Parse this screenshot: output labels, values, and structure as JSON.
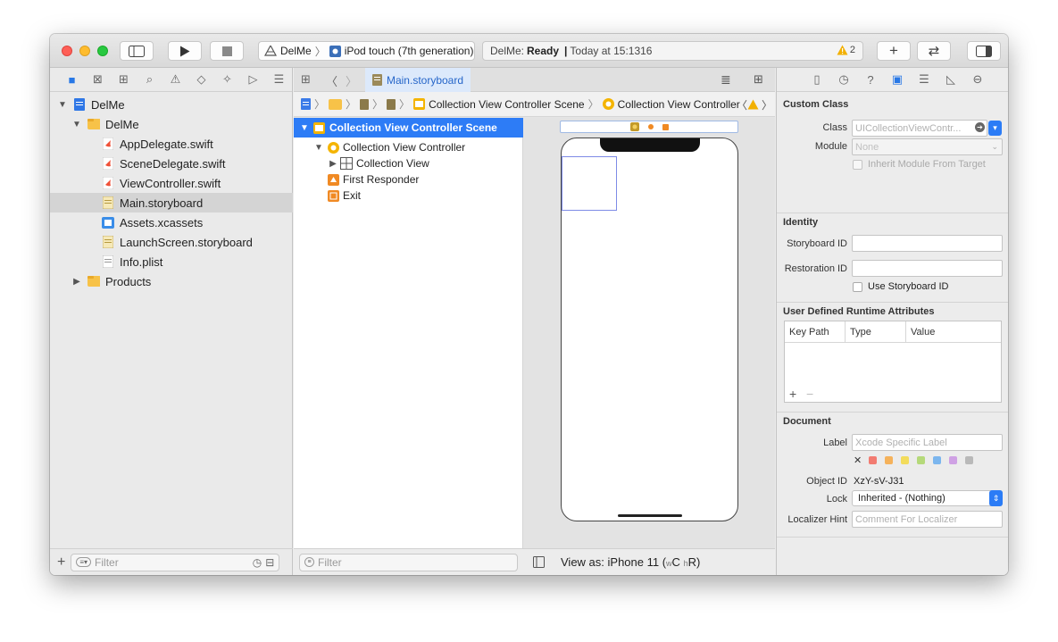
{
  "toolbar": {
    "scheme_project": "DelMe",
    "scheme_device": "iPod touch (7th generation)",
    "status_project": "DelMe:",
    "status_state": "Ready",
    "status_separator": "|",
    "status_time": "Today at 15:1316",
    "warning_count": "2",
    "add_label": "+",
    "swap_label": "⇄"
  },
  "navigator": {
    "tree": [
      {
        "label": "DelMe",
        "level": 0,
        "kind": "project",
        "expanded": true
      },
      {
        "label": "DelMe",
        "level": 1,
        "kind": "folder",
        "expanded": true
      },
      {
        "label": "AppDelegate.swift",
        "level": 2,
        "kind": "swift"
      },
      {
        "label": "SceneDelegate.swift",
        "level": 2,
        "kind": "swift"
      },
      {
        "label": "ViewController.swift",
        "level": 2,
        "kind": "swift"
      },
      {
        "label": "Main.storyboard",
        "level": 2,
        "kind": "storyboard",
        "selected": true
      },
      {
        "label": "Assets.xcassets",
        "level": 2,
        "kind": "assets"
      },
      {
        "label": "LaunchScreen.storyboard",
        "level": 2,
        "kind": "storyboard"
      },
      {
        "label": "Info.plist",
        "level": 2,
        "kind": "plist"
      },
      {
        "label": "Products",
        "level": 1,
        "kind": "folder",
        "expanded": false
      }
    ],
    "filter_placeholder": "Filter"
  },
  "editor": {
    "tab_label": "Main.storyboard",
    "jump_scene": "Collection View Controller Scene",
    "jump_controller": "Collection View Controller",
    "outline": {
      "scene": "Collection View Controller Scene",
      "controller": "Collection View Controller",
      "collection_view": "Collection View",
      "first_responder": "First Responder",
      "exit": "Exit"
    },
    "filter_placeholder": "Filter",
    "view_as_prefix": "View as: iPhone 11 (",
    "view_as_w": "w",
    "view_as_c": "C",
    "view_as_h": "h",
    "view_as_r": "R",
    "view_as_suffix": ")"
  },
  "inspector": {
    "custom_class": {
      "title": "Custom Class",
      "class_label": "Class",
      "class_placeholder": "UICollectionViewContr...",
      "module_label": "Module",
      "module_value": "None",
      "inherit_label": "Inherit Module From Target"
    },
    "identity": {
      "title": "Identity",
      "storyboard_id_label": "Storyboard ID",
      "restoration_id_label": "Restoration ID",
      "use_storyboard_id_label": "Use Storyboard ID"
    },
    "udra": {
      "title": "User Defined Runtime Attributes",
      "col_key_path": "Key Path",
      "col_type": "Type",
      "col_value": "Value",
      "add": "+",
      "remove": "−"
    },
    "document": {
      "title": "Document",
      "label_label": "Label",
      "label_placeholder": "Xcode Specific Label",
      "clear_glyph": "✕",
      "swatches": [
        "#f27b71",
        "#f5b25b",
        "#f3dc5c",
        "#b5d97a",
        "#7cb6ee",
        "#cfa1e4",
        "#b9b9b9"
      ],
      "object_id_label": "Object ID",
      "object_id_value": "XzY-sV-J31",
      "lock_label": "Lock",
      "lock_value": "Inherited - (Nothing)",
      "localizer_hint_label": "Localizer Hint",
      "localizer_placeholder": "Comment For Localizer"
    }
  }
}
